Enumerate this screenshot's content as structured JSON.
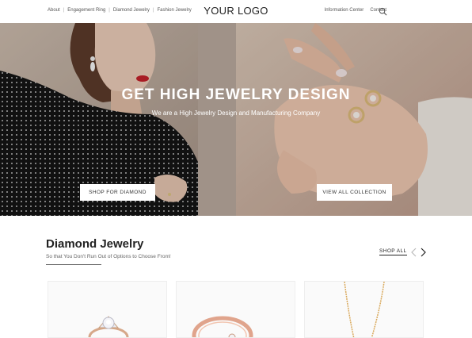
{
  "header": {
    "nav_left": [
      "About",
      "Engagement Ring",
      "Diamond Jewelry",
      "Fashion Jewelry"
    ],
    "logo": "YOUR LOGO",
    "nav_right": [
      "Information Center",
      "Contact"
    ],
    "search_icon": "search-icon"
  },
  "hero": {
    "title": "GET HIGH JEWELRY DESIGN",
    "subtitle": "We are a High Jewelry Design and Manufacturing Company",
    "button_left": "SHOP FOR DIAMOND",
    "button_right": "VIEW ALL COLLECTION"
  },
  "section": {
    "title": "Diamond Jewelry",
    "subtitle": "So that You Don't Run Out of Options to Choose From!",
    "shop_all": "SHOP ALL",
    "prev_icon": "chevron-left-icon",
    "next_icon": "chevron-right-icon"
  },
  "products": [
    {
      "image": "diamond-ring"
    },
    {
      "image": "rose-gold-ring"
    },
    {
      "image": "gold-necklace"
    }
  ]
}
